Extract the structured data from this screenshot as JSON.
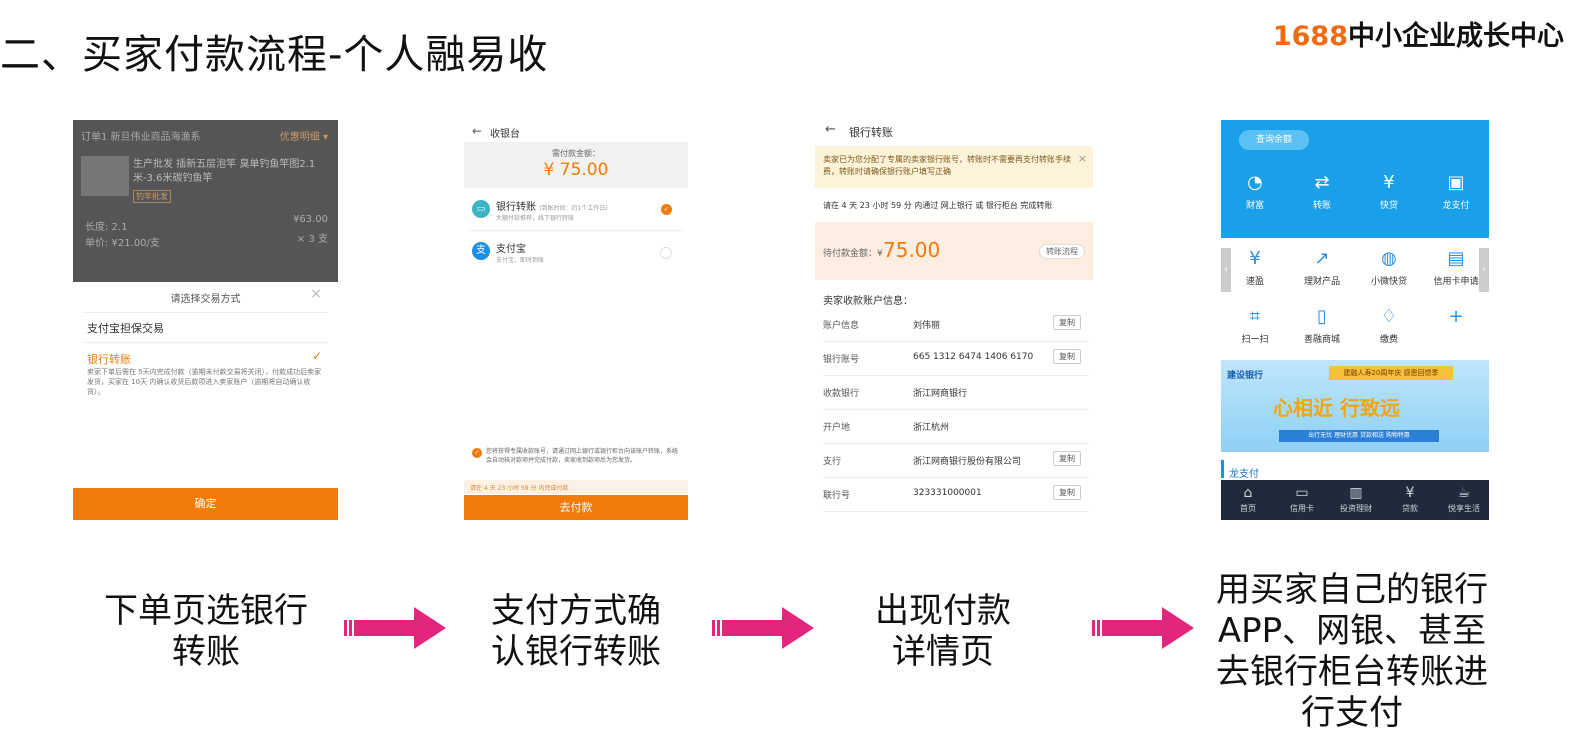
{
  "title": "二、买家付款流程-个人融易收",
  "brand": {
    "num": "1688",
    "text": "中小企业成长中心"
  },
  "phone1": {
    "order_head": "订单1  新旦伟业商品海渔系",
    "order_tag": "优惠明细 ▾",
    "product_name": "生产批发 插新五层泡竿 臭单钓鱼竿图2.1米-3.6米碳钓鱼竿",
    "product_badge": "钓竿批发",
    "spec": "长度: 2.1",
    "unit_price": "单价: ¥21.00/支",
    "total": "¥63.00",
    "qty": "× 3 支",
    "sheet_title": "请选择交易方式",
    "option1": "支付宝担保交易",
    "option2": "银行转账",
    "option2_desc": "卖家下单后需在 5天内完成付款（逾期未付款交易将关闭），付款成功后卖家发货，买家在 10天 内确认收货后款项进入卖家账户（逾期将自动确认收货）。",
    "confirm": "确定"
  },
  "phone2": {
    "back_title": "收银台",
    "amount_label": "需付款金额：",
    "amount": "¥ 75.00",
    "method1": "银行转账",
    "method1_tag": "(到账时间：约1个工作日)",
    "method1_desc": "大额付款推荐，线下银行转账",
    "method2": "支付宝",
    "method2_desc": "支付宝，即时到账",
    "notice": "您将获得专属收款账号，请通过网上银行或银行柜台向该账户转账，系统会自动核对款项并完成付款，卖家收到款项后为您发货。",
    "countdown": "请在 4 天 23 小时 59 分 内完成付款",
    "pay_btn": "去付款"
  },
  "phone3": {
    "back_title": "银行转账",
    "banner": "卖家已为您分配了专属的卖家银行账号，转账时不需要再支付转账手续费，转账时请确保银行账户填写正确",
    "deadline": "请在 4 天 23 小时 59 分 内通过 网上银行 或 银行柜台 完成转账",
    "pay_amount_label": "待付款金额：¥",
    "pay_amount": "75.00",
    "switch": "转账流程",
    "section_title": "卖家收款账户信息：",
    "copy": "复制",
    "rows": [
      {
        "k": "账户信息",
        "v": "刘伟丽",
        "copy": true
      },
      {
        "k": "银行账号",
        "v": "665 1312 6474 1406 6170",
        "copy": true
      },
      {
        "k": "收款银行",
        "v": "浙江网商银行",
        "copy": false
      },
      {
        "k": "开户地",
        "v": "浙江杭州",
        "copy": false
      },
      {
        "k": "支行",
        "v": "浙江网商银行股份有限公司",
        "copy": true
      },
      {
        "k": "联行号",
        "v": "323331000001",
        "copy": true
      }
    ]
  },
  "phone4": {
    "balance_btn": "查询余额",
    "top_icons": [
      {
        "ic": "◔",
        "lb": "财富"
      },
      {
        "ic": "⇄",
        "lb": "转账"
      },
      {
        "ic": "¥",
        "lb": "快贷"
      },
      {
        "ic": "▣",
        "lb": "龙支付"
      }
    ],
    "grid1": [
      {
        "ic": "¥",
        "lb": "速盈"
      },
      {
        "ic": "↗",
        "lb": "理财产品"
      },
      {
        "ic": "◍",
        "lb": "小微快贷"
      },
      {
        "ic": "▤",
        "lb": "信用卡申请"
      }
    ],
    "grid2": [
      {
        "ic": "⌗",
        "lb": "扫一扫"
      },
      {
        "ic": "▯",
        "lb": "善融商城"
      },
      {
        "ic": "♢",
        "lb": "缴费"
      },
      {
        "ic": "+",
        "lb": ""
      }
    ],
    "banner_logo": "建设银行",
    "banner_ribbon": "建融人寿20周年庆 感恩回馈季",
    "banner_big": "心相近 行致远",
    "banner_small": "出行无忧  理财优惠  贷款相送  购物特惠",
    "section": "龙支付",
    "tabs": [
      {
        "ic": "⌂",
        "lb": "首页"
      },
      {
        "ic": "▭",
        "lb": "信用卡"
      },
      {
        "ic": "▥",
        "lb": "投资理财"
      },
      {
        "ic": "¥",
        "lb": "贷款"
      },
      {
        "ic": "☕",
        "lb": "悦享生活"
      }
    ]
  },
  "captions": [
    "下单页选银行转账",
    "支付方式确认银行转账",
    "出现付款详情页",
    "用买家自己的银行APP、网银、甚至去银行柜台转账进行支付"
  ],
  "arrow_color": "#e3257b"
}
